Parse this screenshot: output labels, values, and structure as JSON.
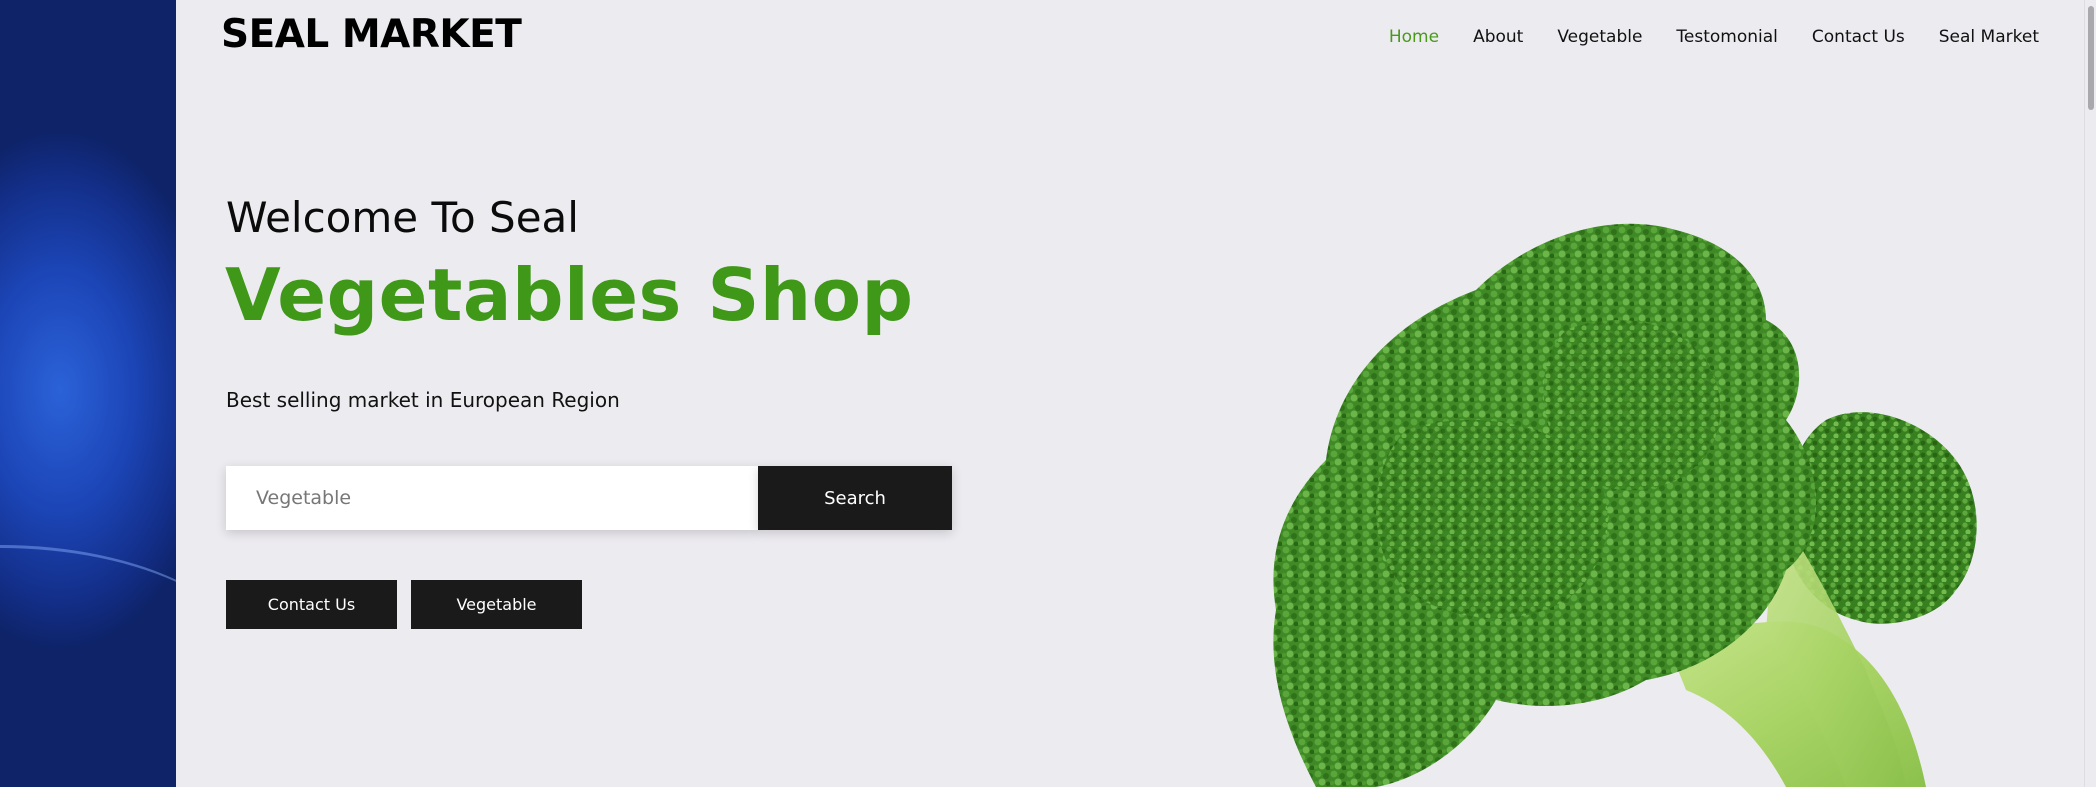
{
  "header": {
    "logo": "SEAL MARKET",
    "nav": [
      "Home",
      "About",
      "Vegetable",
      "Testomonial",
      "Contact Us",
      "Seal Market"
    ],
    "active": "Home"
  },
  "hero": {
    "welcome": "Welcome To Seal",
    "headline": "Vegetables Shop",
    "tagline": "Best selling market in European Region",
    "search": {
      "placeholder": "Vegetable",
      "button_label": "Search"
    },
    "buttons": {
      "contact_label": "Contact Us",
      "vegetable_label": "Vegetable"
    },
    "image": "broccoli"
  },
  "colors": {
    "accent_green": "#3f9817",
    "nav_active": "#4a9a1a",
    "button_dark": "#1a1a1a",
    "page_bg": "#ecebf0"
  }
}
